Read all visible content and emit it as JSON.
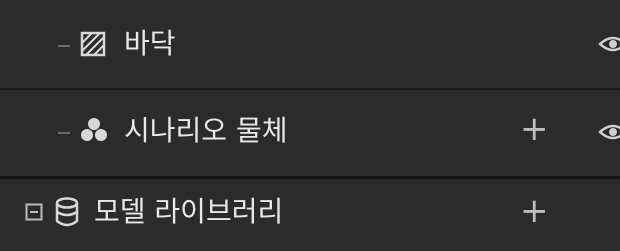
{
  "tree": {
    "items": [
      {
        "label": "바닥",
        "icon": "floor-pattern-icon"
      },
      {
        "label": "시나리오 물체",
        "icon": "objects-cluster-icon",
        "add": "+"
      },
      {
        "label": "모델 라이브러리",
        "icon": "database-icon",
        "add": "+",
        "toggle": "collapse-minus-icon"
      }
    ]
  },
  "colors": {
    "background": "#2b2b2b",
    "separator": "#161616",
    "treeLine": "#6b6b6b",
    "text": "#e9e9e9"
  }
}
